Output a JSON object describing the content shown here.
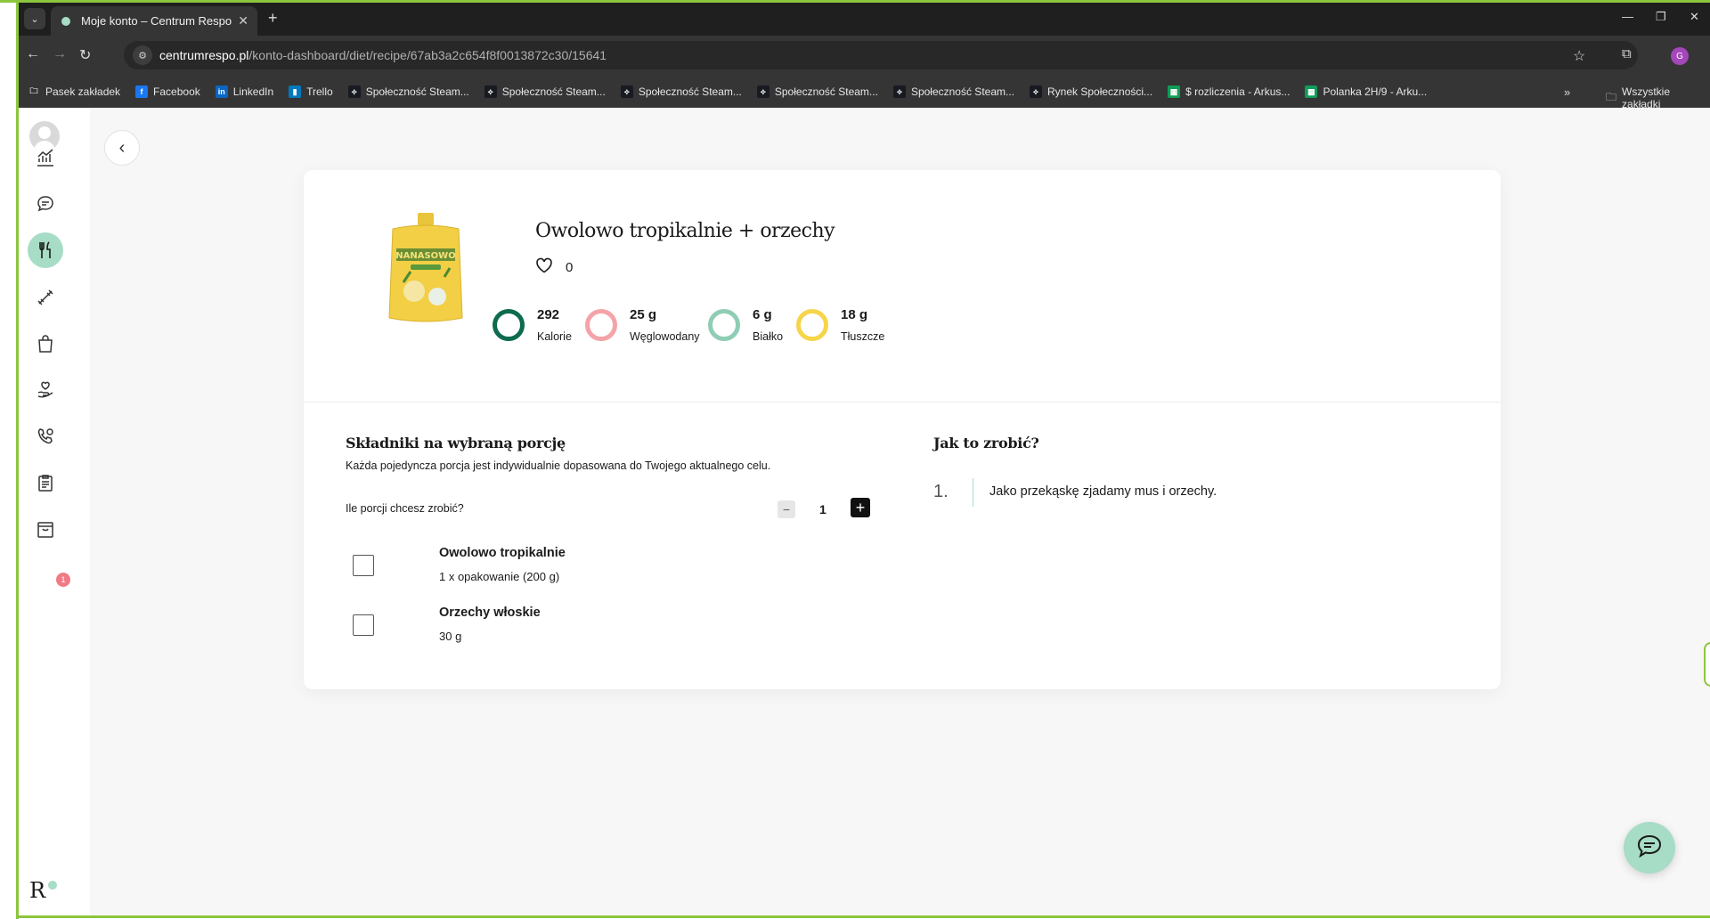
{
  "browser": {
    "tab_title": "Moje konto – Centrum Respo",
    "url_domain": "centrumrespo.pl",
    "url_path": "/konto-dashboard/diet/recipe/67ab3a2c654f8f0013872c30/15641",
    "profile_initial": "G",
    "bookmarks": [
      {
        "label": "Pasek zakładek",
        "icon": "folder-icon",
        "color": "#353535"
      },
      {
        "label": "Facebook",
        "icon": "facebook-icon",
        "color": "#1877f2"
      },
      {
        "label": "LinkedIn",
        "icon": "linkedin-icon",
        "color": "#0a66c2"
      },
      {
        "label": "Trello",
        "icon": "trello-icon",
        "color": "#0079bf"
      },
      {
        "label": "Społeczność Steam...",
        "icon": "steam-icon",
        "color": "#171a21"
      },
      {
        "label": "Społeczność Steam...",
        "icon": "steam-icon",
        "color": "#171a21"
      },
      {
        "label": "Społeczność Steam...",
        "icon": "steam-icon",
        "color": "#171a21"
      },
      {
        "label": "Społeczność Steam...",
        "icon": "steam-icon",
        "color": "#171a21"
      },
      {
        "label": "Społeczność Steam...",
        "icon": "steam-icon",
        "color": "#171a21"
      },
      {
        "label": "Rynek Społeczności...",
        "icon": "steam-icon",
        "color": "#171a21"
      },
      {
        "label": "$ rozliczenia - Arkus...",
        "icon": "sheets-icon",
        "color": "#0f9d58"
      },
      {
        "label": "Polanka 2H/9 - Arku...",
        "icon": "sheets-icon",
        "color": "#0f9d58"
      }
    ],
    "all_bookmarks": "Wszystkie zakładki"
  },
  "sidebar": {
    "notifications_badge": "1"
  },
  "recipe": {
    "title": "Owolowo tropikalnie + orzechy",
    "likes": "0",
    "macros": [
      {
        "value": "292",
        "label": "Kalorie",
        "color": "#0d6b4f"
      },
      {
        "value": "25 g",
        "label": "Węglowodany",
        "color": "#f4a3a8"
      },
      {
        "value": "6 g",
        "label": "Białko",
        "color": "#8fcdb4"
      },
      {
        "value": "18 g",
        "label": "Tłuszcze",
        "color": "#f7d54a"
      }
    ],
    "product_text": "NANASOWO"
  },
  "ingredients": {
    "title": "Składniki na wybraną porcję",
    "subtitle": "Każda pojedyncza porcja jest indywidualnie dopasowana do Twojego aktualnego celu.",
    "portions_label": "Ile porcji chcesz zrobić?",
    "portions": "1",
    "items": [
      {
        "name": "Owolowo tropikalnie",
        "amount": "1 x opakowanie (200 g)"
      },
      {
        "name": "Orzechy włoskie",
        "amount": "30 g"
      }
    ]
  },
  "instructions": {
    "title": "Jak to zrobić?",
    "steps": [
      {
        "num": "1.",
        "text": "Jako przekąskę zjadamy mus i orzechy."
      }
    ]
  },
  "logo": "R"
}
